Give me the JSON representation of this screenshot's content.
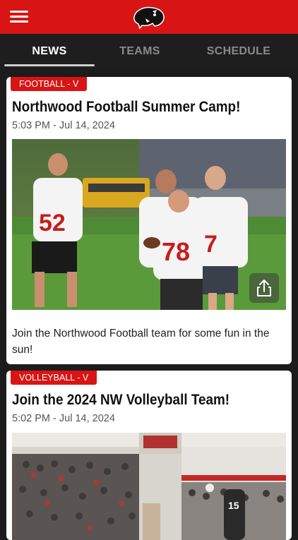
{
  "tabs": [
    {
      "label": "NEWS",
      "active": true
    },
    {
      "label": "TEAMS",
      "active": false
    },
    {
      "label": "SCHEDULE",
      "active": false
    }
  ],
  "colors": {
    "brand": "#d91414",
    "tab_bg": "#1e1e1e",
    "card_bg": "#ffffff"
  },
  "icons": {
    "menu": "hamburger-menu-icon",
    "logo": "panther-logo",
    "share": "share-icon"
  },
  "articles": [
    {
      "category": "FOOTBALL - V",
      "title": "Northwood Football Summer Camp!",
      "time": "5:03 PM - Jul 14, 2024",
      "description": "Join the Northwood Football team for some fun in the sun!"
    },
    {
      "category": "VOLLEYBALL - V",
      "title": "Join the 2024 NW Volleyball Team!",
      "time": "5:02 PM - Jul 14, 2024"
    }
  ]
}
